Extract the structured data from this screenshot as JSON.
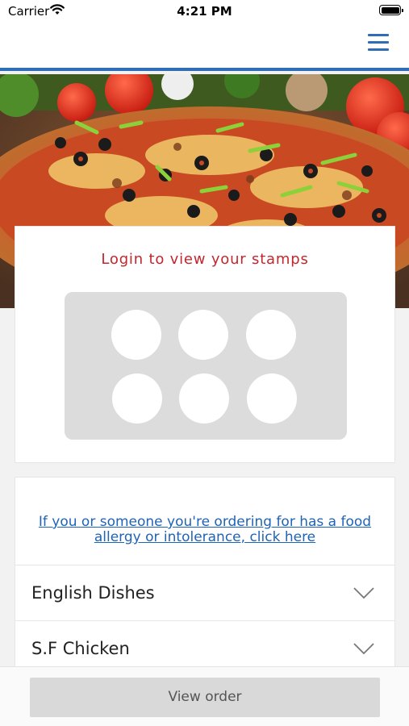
{
  "status_bar": {
    "carrier": "Carrier",
    "time": "4:21 PM",
    "wifi_icon": "wifi-icon",
    "battery_icon": "battery-icon"
  },
  "nav": {
    "menu_icon": "hamburger-menu-icon",
    "accent_color": "#2f6db7"
  },
  "hero": {
    "image": "pizza-banner-image"
  },
  "stamps": {
    "title": "Login to view your stamps",
    "slots": 6,
    "title_color": "#c4262e"
  },
  "allergy": {
    "link_text": "If you or someone you're ordering for has a food allergy or intolerance, click here",
    "link_color": "#1f63b5"
  },
  "categories": [
    {
      "label": "English Dishes",
      "icon": "chevron-down-icon"
    },
    {
      "label": "S.F Chicken",
      "icon": "chevron-down-icon"
    }
  ],
  "footer": {
    "button_label": "View order"
  }
}
